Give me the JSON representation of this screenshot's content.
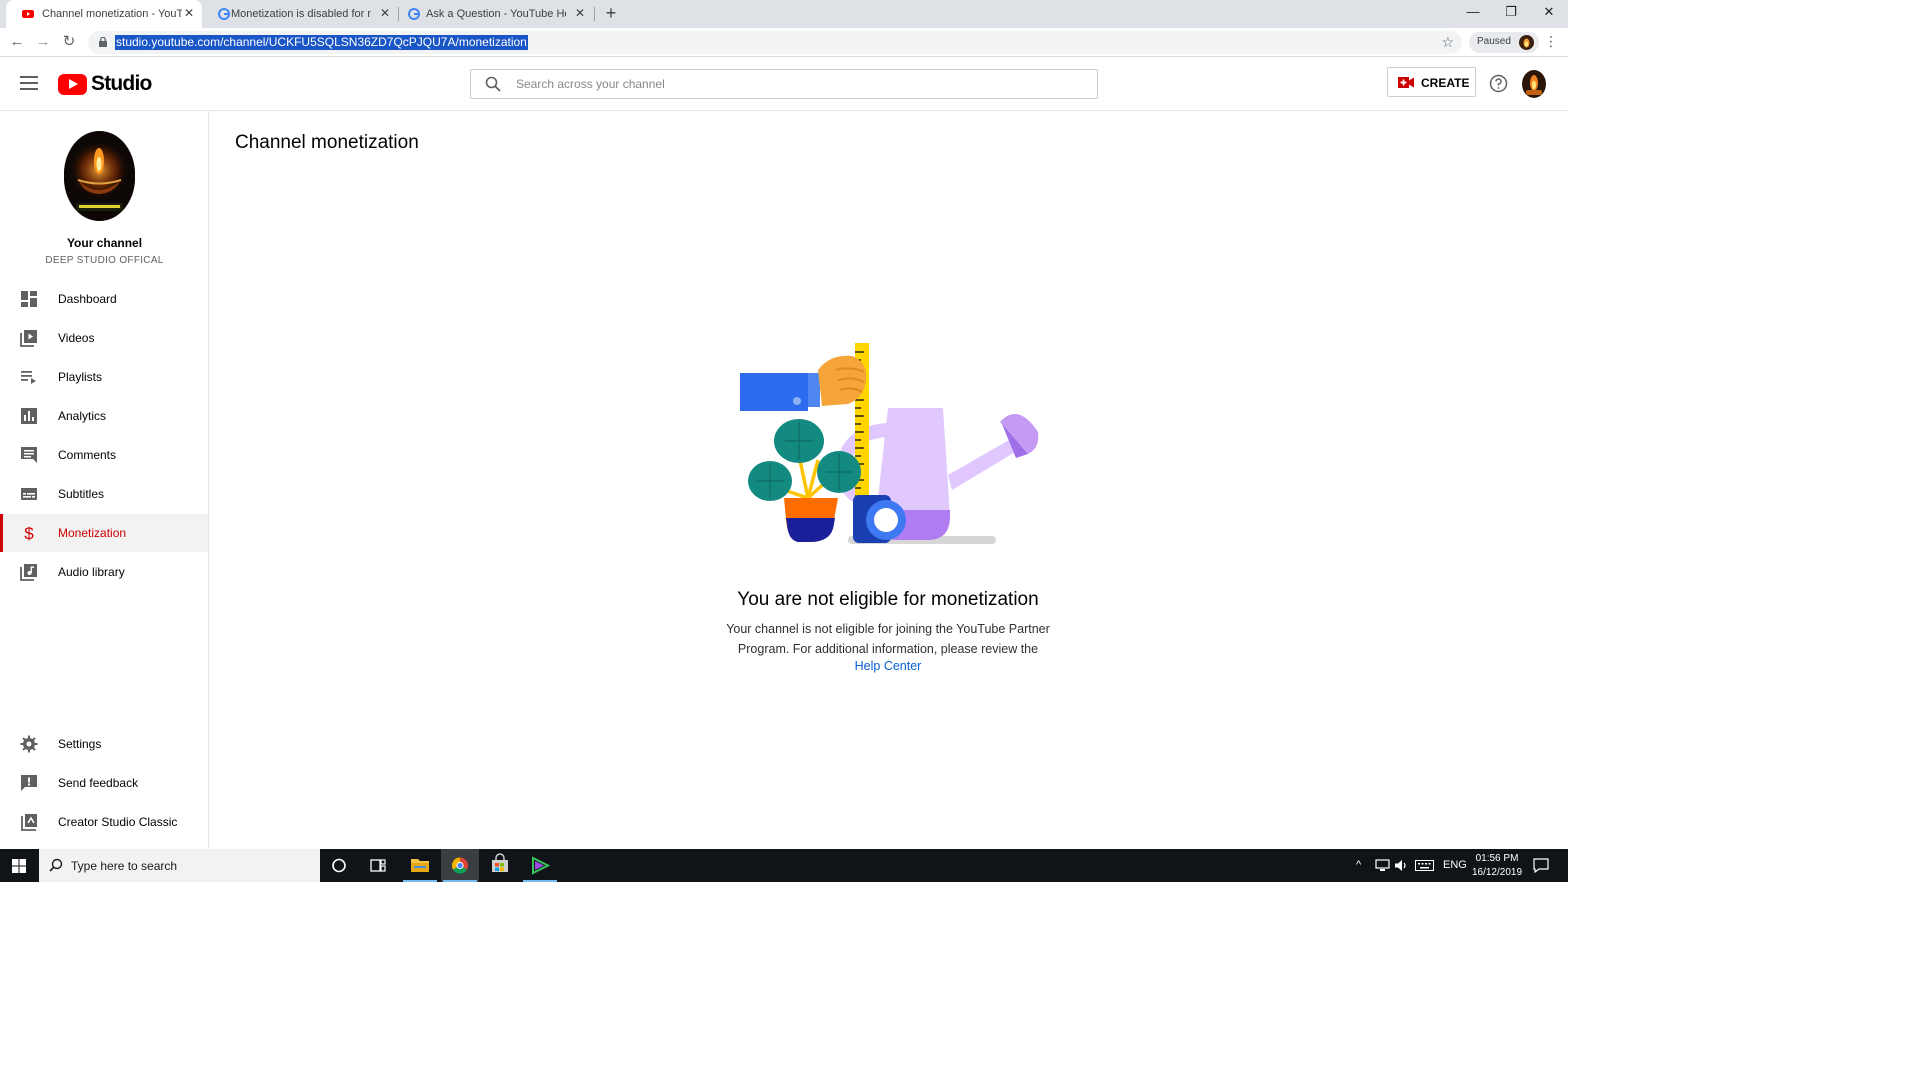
{
  "browser": {
    "tabs": [
      {
        "title": "Channel monetization - YouTube",
        "favicon": "youtube-icon"
      },
      {
        "title": "Monetization is disabled for my c",
        "favicon": "google-icon"
      },
      {
        "title": "Ask a Question - YouTube Help",
        "favicon": "google-icon"
      }
    ],
    "url": "studio.youtube.com/channel/UCKFU5SQLSN36ZD7QcPJQU7A/monetization",
    "profile_label": "Paused"
  },
  "header": {
    "logo_text": "Studio",
    "search_placeholder": "Search across your channel",
    "create_label": "CREATE"
  },
  "sidebar": {
    "channel_title": "Your channel",
    "channel_name": "DEEP STUDIO OFFICAL",
    "items": [
      {
        "label": "Dashboard",
        "icon": "dashboard-icon"
      },
      {
        "label": "Videos",
        "icon": "videos-icon"
      },
      {
        "label": "Playlists",
        "icon": "playlists-icon"
      },
      {
        "label": "Analytics",
        "icon": "analytics-icon"
      },
      {
        "label": "Comments",
        "icon": "comments-icon"
      },
      {
        "label": "Subtitles",
        "icon": "subtitles-icon"
      },
      {
        "label": "Monetization",
        "icon": "dollar-icon",
        "active": true
      },
      {
        "label": "Audio library",
        "icon": "audio-library-icon"
      }
    ],
    "bottom_items": [
      {
        "label": "Settings",
        "icon": "gear-icon"
      },
      {
        "label": "Send feedback",
        "icon": "feedback-icon"
      },
      {
        "label": "Creator Studio Classic",
        "icon": "classic-studio-icon"
      }
    ]
  },
  "main": {
    "page_title": "Channel monetization",
    "headline": "You are not eligible for monetization",
    "description": "Your channel is not eligible for joining the YouTube Partner Program. For additional information, please review the",
    "help_link": "Help Center"
  },
  "taskbar": {
    "search_placeholder": "Type here to search",
    "language": "ENG",
    "time": "01:56 PM",
    "date": "16/12/2019"
  },
  "colors": {
    "accent_red": "#cc0000",
    "youtube_red": "#ff0000",
    "link_blue": "#065fd4",
    "url_highlight": "#1a56c6"
  }
}
